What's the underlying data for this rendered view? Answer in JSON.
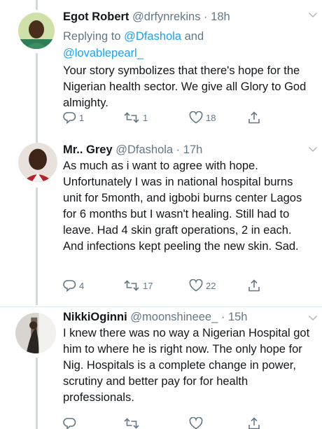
{
  "tweets": [
    {
      "name": "Egot Robert",
      "handle": "@drfynrekins",
      "time": "18h",
      "replying_prefix": "Replying to ",
      "replying_user1": "@Dfashola",
      "replying_and": " and",
      "replying_user2": "@lovablepearl_",
      "text": "Your story symbolizes that there's hope for the Nigerian health sector. We give all Glory to God almighty.",
      "replies": "1",
      "retweets": "1",
      "likes": "18"
    },
    {
      "name": "Mr.. Grey",
      "handle": "@Dfashola",
      "time": "17h",
      "text": "As much as i want to agree with hope. Unfortunately I was in national hospital burns unit for 5month, and igbobi burns center Lagos for 6 months but I wasn't healing. Still had to leave. Had 4 skin graft operations, 2 in each. And infections kept peeling the new skin. Sad.",
      "replies": "4",
      "retweets": "17",
      "likes": "22"
    },
    {
      "name": "NikkiOginni",
      "handle": "@moonshineee_",
      "time": "15h",
      "text": "I knew there was no way a Nigerian Hospital got him to where he is right now. The only hope for Nig. Hospitals is a complete change in power, scrutiny and better pay for for health professionals."
    }
  ],
  "separator": " · ",
  "colors": {
    "link": "#1da1f2",
    "muted": "#657786",
    "thread": "#cfd9de"
  }
}
